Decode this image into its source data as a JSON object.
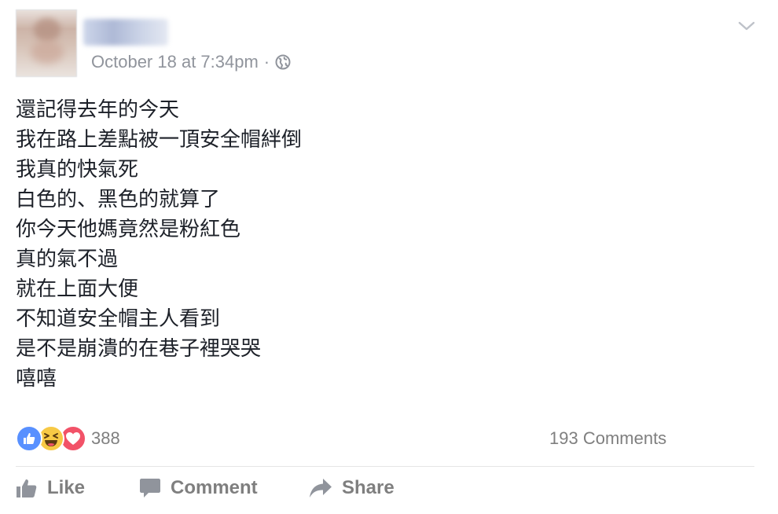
{
  "post": {
    "timestamp": "October 18 at 7:34pm",
    "separator": "·",
    "privacy_icon": "globe-icon",
    "menu_icon": "chevron-down-icon",
    "lines": [
      "還記得去年的今天",
      "我在路上差點被一頂安全帽絆倒",
      "我真的快氣死",
      "白色的、黑色的就算了",
      "你今天他媽竟然是粉紅色",
      "真的氣不過",
      "就在上面大便",
      "不知道安全帽主人看到",
      "是不是崩潰的在巷子裡哭哭",
      "嘻嘻"
    ]
  },
  "stats": {
    "reaction_icons": [
      "like-reaction-icon",
      "haha-reaction-icon",
      "love-reaction-icon"
    ],
    "reaction_count": "388",
    "comments_label": "193 Comments"
  },
  "actions": {
    "like": "Like",
    "comment": "Comment",
    "share": "Share"
  },
  "colors": {
    "like_blue": "#5890ff",
    "haha_yellow": "#f7c945",
    "love_red": "#f25268",
    "meta_gray": "#90949c",
    "action_gray": "#7f7f7f"
  }
}
